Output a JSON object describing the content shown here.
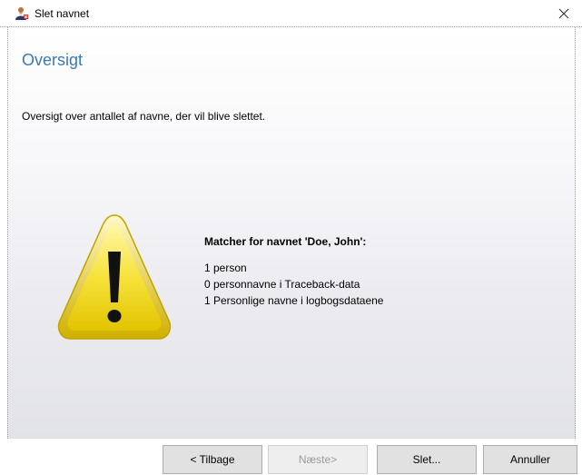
{
  "window": {
    "title": "Slet navnet",
    "icon": "user-delete-icon",
    "close_icon": "close-icon"
  },
  "page": {
    "heading": "Oversigt",
    "description": "Oversigt over antallet af navne, der vil blive slettet."
  },
  "summary": {
    "icon": "warning-icon",
    "heading": "Matcher for navnet 'Doe, John':",
    "lines": [
      "1 person",
      "0 personnavne i Traceback-data",
      "1 Personlige navne i logbogsdataene"
    ]
  },
  "buttons": {
    "back": "< Tilbage",
    "next": "Næste>",
    "delete": "Slet...",
    "cancel": "Annuller"
  },
  "colors": {
    "heading": "#3c78b5",
    "warning_fill": "#f7e33a",
    "warning_border": "#c9b000"
  }
}
